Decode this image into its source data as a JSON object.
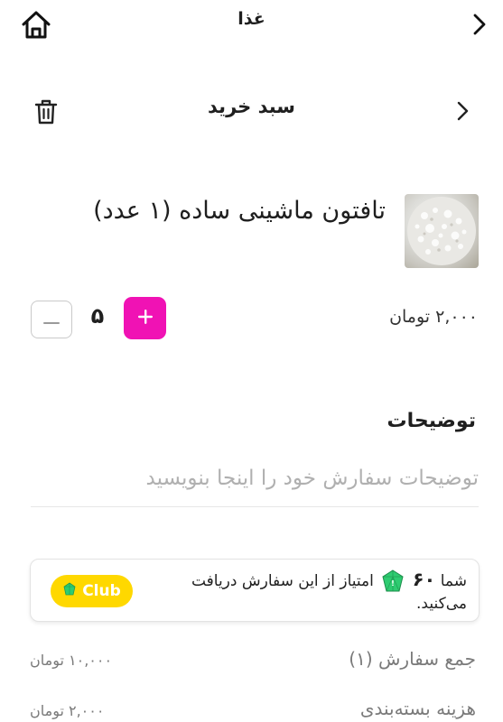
{
  "header": {
    "title": "غذا"
  },
  "cart": {
    "title": "سبد خرید"
  },
  "product": {
    "name": "تافتون ماشینی ساده (۱ عدد)",
    "price": "۲,۰۰۰ تومان",
    "quantity": "۵"
  },
  "notes": {
    "title": "توضیحات",
    "placeholder": "توضیحات سفارش خود را اینجا بنویسید",
    "value": ""
  },
  "club": {
    "prefix": "شما",
    "points": "۶۰",
    "message": "امتیاز از این سفارش دریافت می‌کنید.",
    "badge_label": "Club",
    "badge_color": "#ffd800",
    "gem_color": "#2ecc71"
  },
  "summary": {
    "rows": [
      {
        "label": "جمع سفارش (۱)",
        "value": "۱۰,۰۰۰ تومان"
      },
      {
        "label": "هزینه بسته‌بندی",
        "value": "۲,۰۰۰ تومان"
      }
    ]
  },
  "colors": {
    "accent": "#f012b4",
    "text": "#1f1f1f",
    "muted": "#7a7a7a"
  },
  "icons": {
    "home": "home-icon",
    "back": "chevron-right-icon",
    "trash": "trash-icon",
    "minus": "minus-icon",
    "plus": "plus-icon",
    "gem": "gem-icon"
  }
}
